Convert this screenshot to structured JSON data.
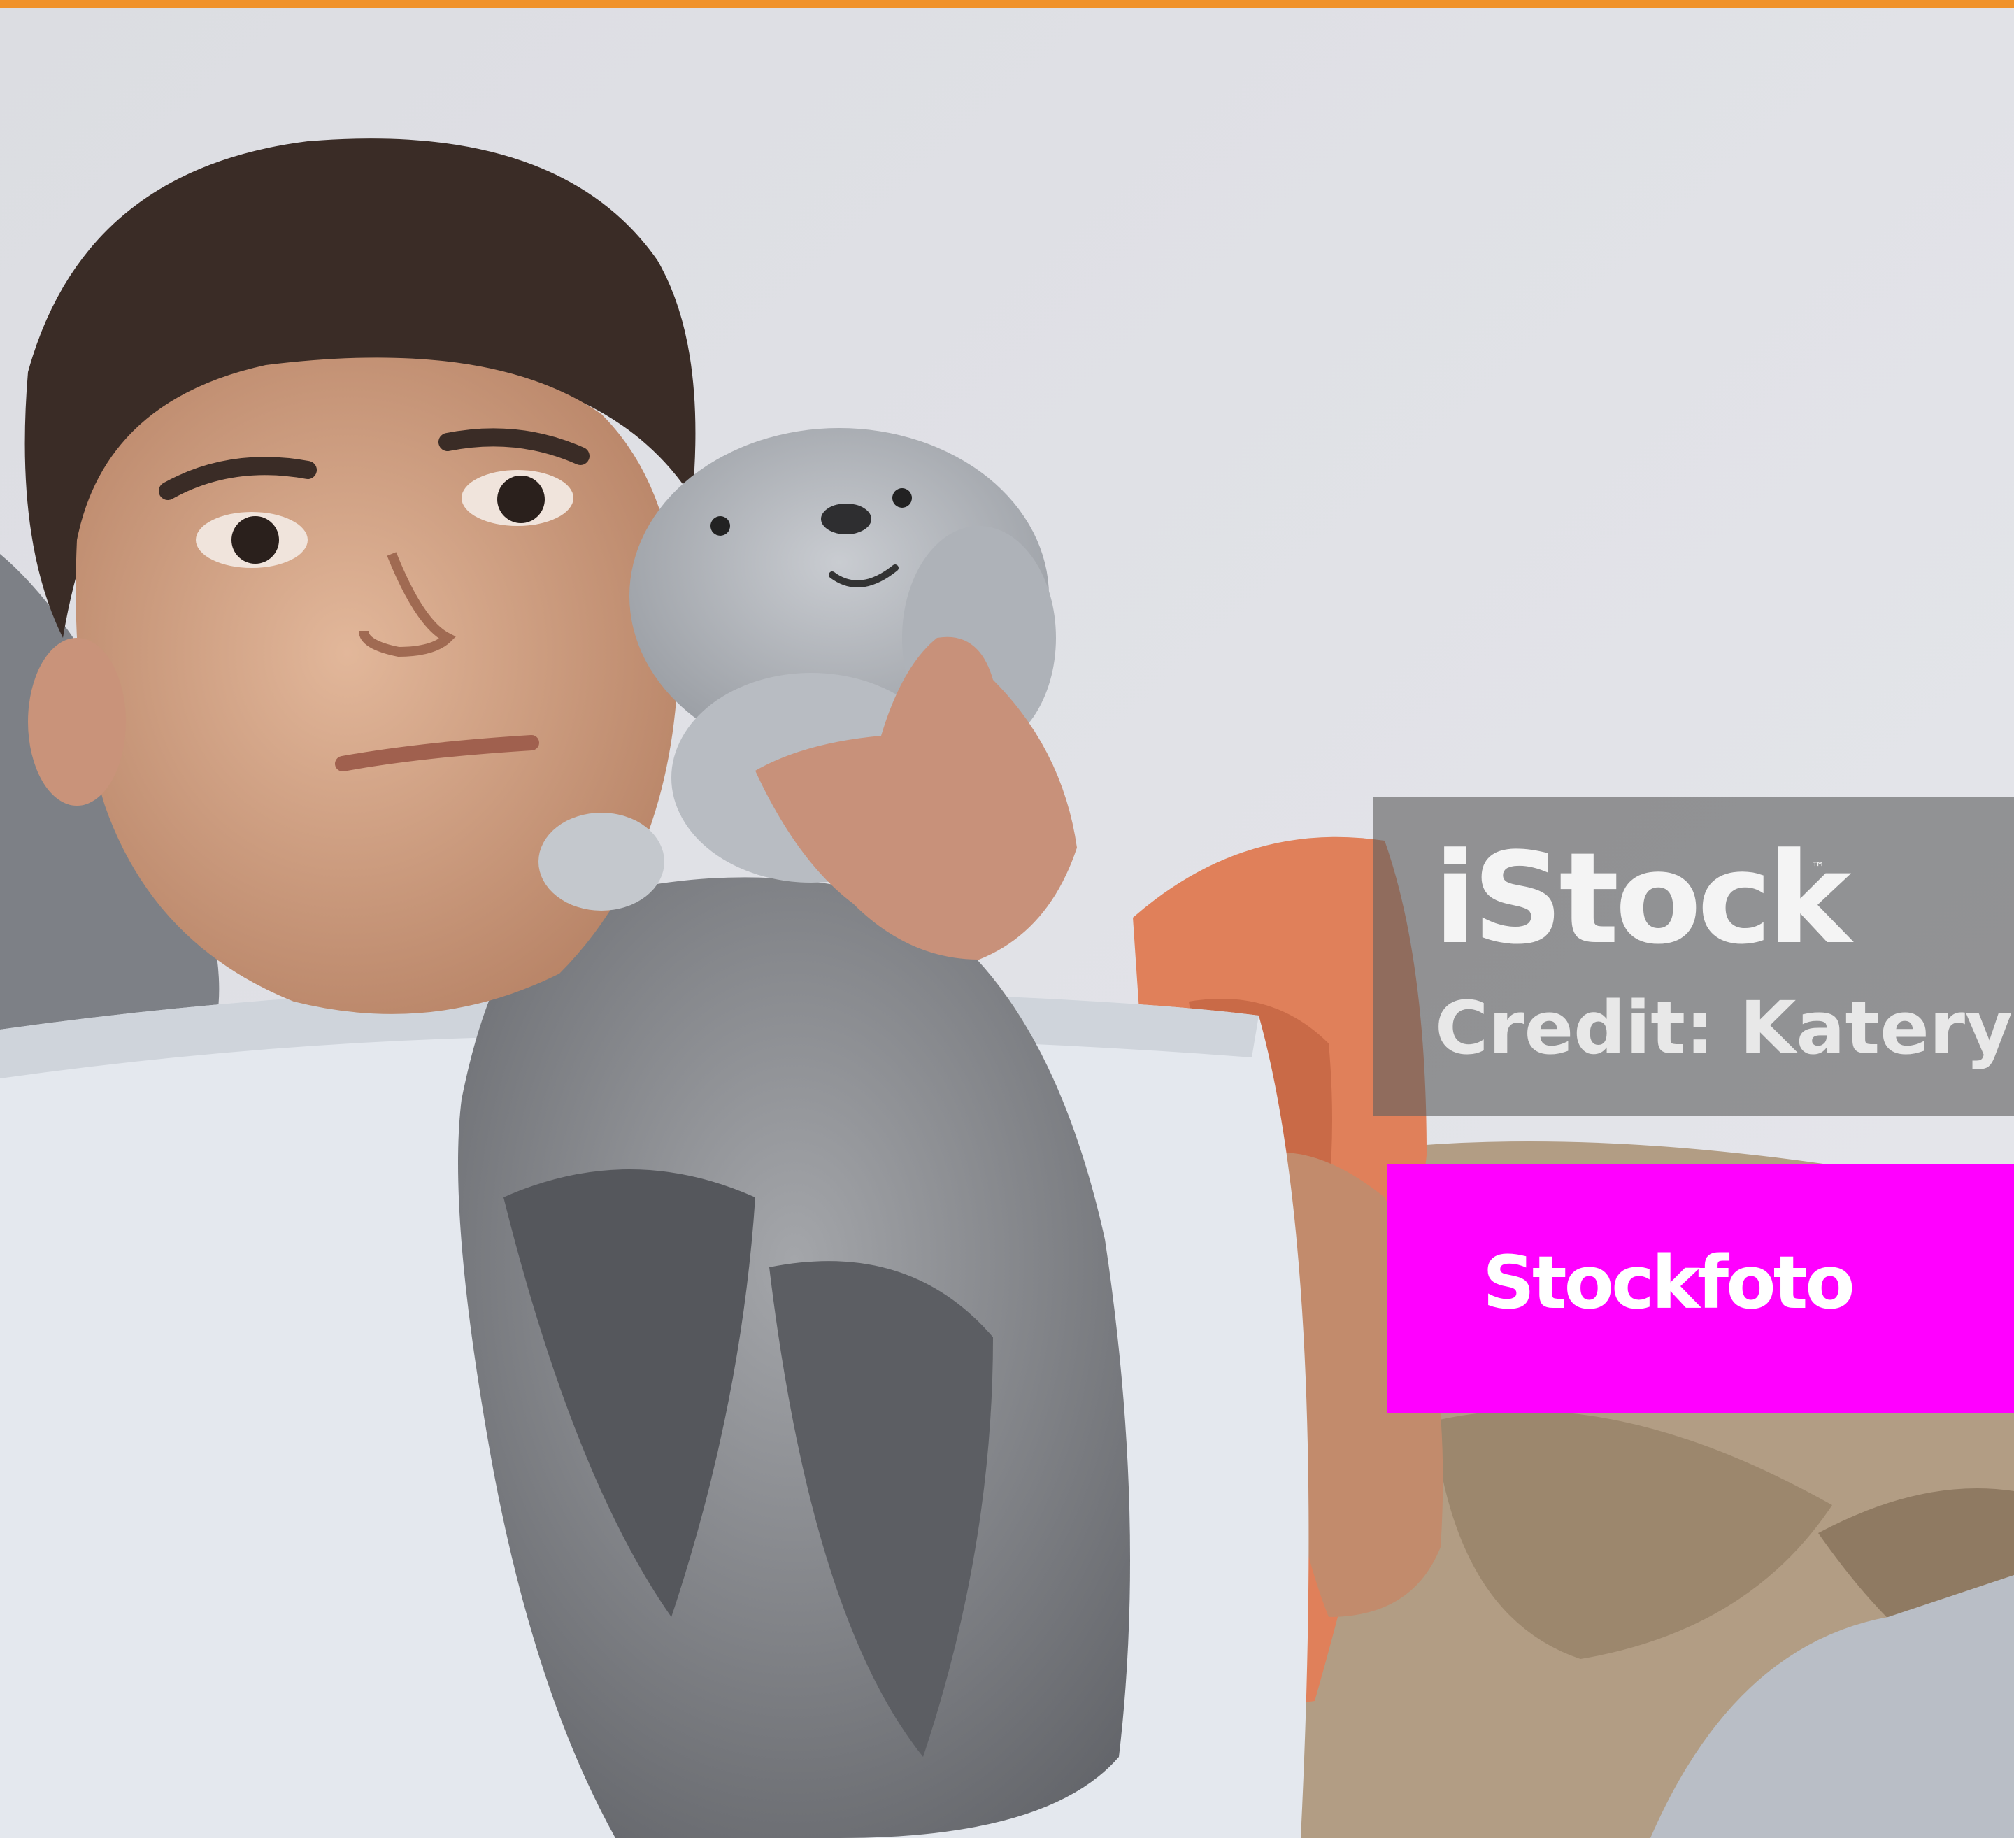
{
  "watermark": {
    "brand": "iStock",
    "trademark": "™",
    "credit": "Credit: Katery"
  },
  "banner": {
    "label": "Stockfoto"
  },
  "colors": {
    "top_bar": "#f0922a",
    "banner": "#ff00ff",
    "watermark_panel": "#5f5f5f"
  },
  "photo": {
    "subject_icon": "child-with-plush-toy-photo"
  }
}
